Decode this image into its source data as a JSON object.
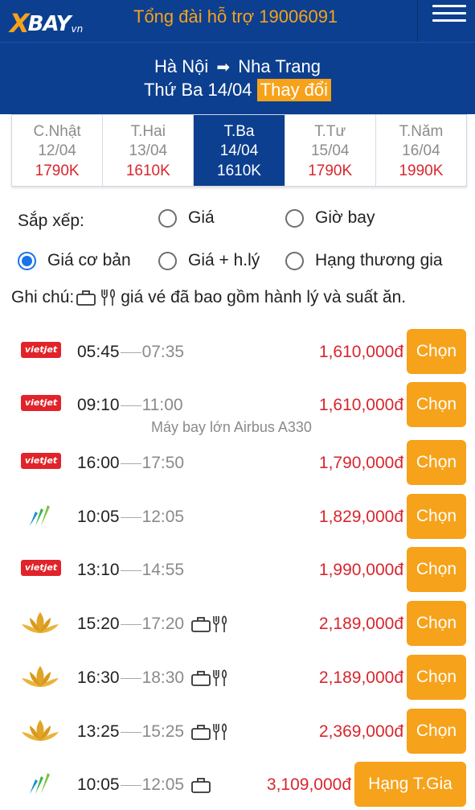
{
  "header": {
    "logo_text": "BAY",
    "logo_suffix": "vn",
    "hotline": "Tổng đài hỗ trợ 19006091"
  },
  "search": {
    "origin": "Hà Nội",
    "destination": "Nha Trang",
    "date": "Thứ Ba 14/04",
    "change_label": "Thay đổi"
  },
  "days": [
    {
      "name": "C.Nhật",
      "date": "12/04",
      "price": "1790K"
    },
    {
      "name": "T.Hai",
      "date": "13/04",
      "price": "1610K"
    },
    {
      "name": "T.Ba",
      "date": "14/04",
      "price": "1610K"
    },
    {
      "name": "T.Tư",
      "date": "15/04",
      "price": "1790K"
    },
    {
      "name": "T.Năm",
      "date": "16/04",
      "price": "1990K"
    }
  ],
  "active_day": "T.Ba",
  "sort": {
    "label": "Sắp xếp:",
    "options": [
      "Giá",
      "Giờ bay",
      "Giá cơ bản",
      "Giá + h.lý",
      "Hạng thương gia"
    ],
    "selected": "Giá cơ bản"
  },
  "note": {
    "prefix": "Ghi chú:",
    "text": "giá vé đã bao gồm hành lý và suất ăn."
  },
  "flights": [
    {
      "airline": "vietjet",
      "logo_text": "vietjet",
      "dep": "05:45",
      "arr": "07:35",
      "price": "1,610,000đ",
      "button": "Chọn",
      "amenities": []
    },
    {
      "airline": "vietjet",
      "logo_text": "vietjet",
      "dep": "09:10",
      "arr": "11:00",
      "price": "1,610,000đ",
      "button": "Chọn",
      "amenities": [],
      "note": "Máy bay lớn Airbus A330"
    },
    {
      "airline": "vietjet",
      "logo_text": "vietjet",
      "dep": "16:00",
      "arr": "17:50",
      "price": "1,790,000đ",
      "button": "Chọn",
      "amenities": []
    },
    {
      "airline": "bamboo",
      "dep": "10:05",
      "arr": "12:05",
      "price": "1,829,000đ",
      "button": "Chọn",
      "amenities": []
    },
    {
      "airline": "vietjet",
      "logo_text": "vietjet",
      "dep": "13:10",
      "arr": "14:55",
      "price": "1,990,000đ",
      "button": "Chọn",
      "amenities": []
    },
    {
      "airline": "vietnam-airlines",
      "dep": "15:20",
      "arr": "17:20",
      "price": "2,189,000đ",
      "button": "Chọn",
      "amenities": [
        "baggage",
        "meal"
      ]
    },
    {
      "airline": "vietnam-airlines",
      "dep": "16:30",
      "arr": "18:30",
      "price": "2,189,000đ",
      "button": "Chọn",
      "amenities": [
        "baggage",
        "meal"
      ]
    },
    {
      "airline": "vietnam-airlines",
      "dep": "13:25",
      "arr": "15:25",
      "price": "2,369,000đ",
      "button": "Chọn",
      "amenities": [
        "baggage",
        "meal"
      ]
    },
    {
      "airline": "bamboo",
      "dep": "10:05",
      "arr": "12:05",
      "price": "3,109,000đ",
      "button": "Hạng T.Gia",
      "amenities": [
        "baggage"
      ]
    }
  ],
  "colors": {
    "brand_blue": "#0c3f8f",
    "accent_orange": "#f6a21a",
    "price_red": "#d8262d",
    "radio_blue": "#1a73e8"
  }
}
